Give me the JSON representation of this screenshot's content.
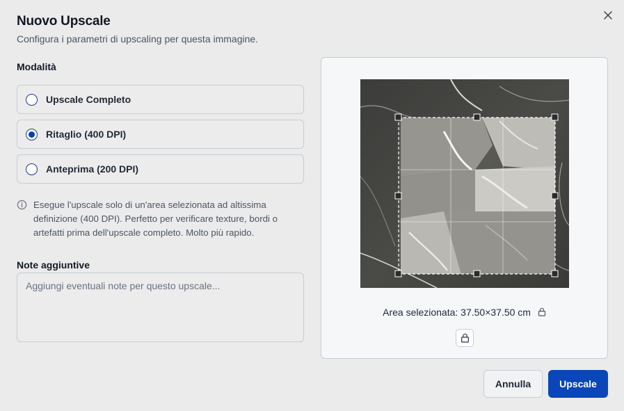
{
  "dialog": {
    "title": "Nuovo Upscale",
    "subtitle": "Configura i parametri di upscaling per questa immagine.",
    "close_icon": "close-icon"
  },
  "mode": {
    "label": "Modalità",
    "options": [
      {
        "label": "Upscale Completo",
        "selected": false
      },
      {
        "label": "Ritaglio (400 DPI)",
        "selected": true
      },
      {
        "label": "Anteprima (200 DPI)",
        "selected": false
      }
    ],
    "info_icon": "info-icon",
    "info_text": "Esegue l'upscale solo di un'area selezionata ad altissima definizione (400 DPI). Perfetto per verificare texture, bordi o artefatti prima dell'upscale completo. Molto più rapido."
  },
  "notes": {
    "label": "Note aggiuntive",
    "placeholder": "Aggiungi eventuali note per questo upscale...",
    "value": ""
  },
  "preview": {
    "area_label": "Area selezionata: 37.50×37.50 cm",
    "lock_icon": "lock-icon",
    "image_icon": "marble-texture-image"
  },
  "footer": {
    "cancel_label": "Annulla",
    "submit_label": "Upscale"
  },
  "colors": {
    "primary": "#0b46b8",
    "radio_selected": "#0b3fae",
    "background": "#ebebeb"
  }
}
